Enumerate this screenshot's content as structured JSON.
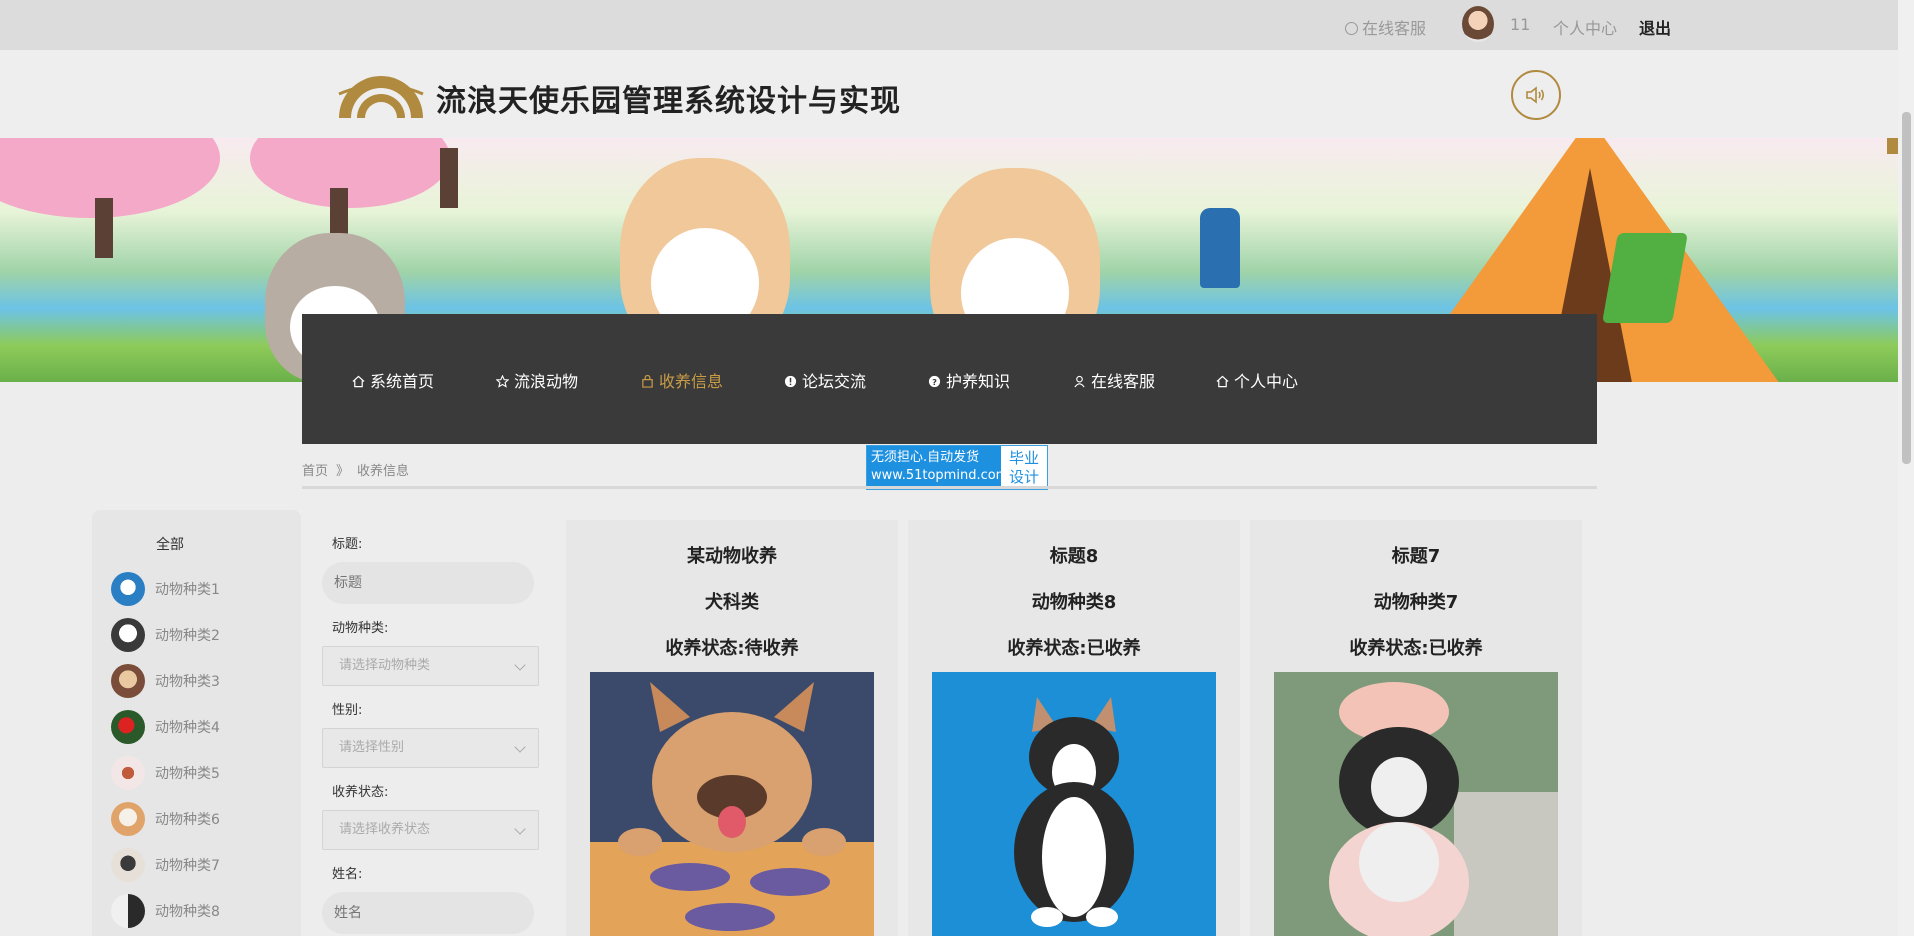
{
  "topbar": {
    "service_label": "在线客服",
    "username": "11",
    "center_label": "个人中心",
    "logout_label": "退出"
  },
  "header": {
    "title": "流浪天使乐园管理系统设计与实现"
  },
  "nav": {
    "items": [
      {
        "label": "系统首页",
        "icon": "home-icon"
      },
      {
        "label": "流浪动物",
        "icon": "star-icon"
      },
      {
        "label": "收养信息",
        "icon": "bag-icon",
        "active": true
      },
      {
        "label": "论坛交流",
        "icon": "alert-icon"
      },
      {
        "label": "护养知识",
        "icon": "question-icon"
      },
      {
        "label": "在线客服",
        "icon": "user-icon"
      },
      {
        "label": "个人中心",
        "icon": "home-icon"
      }
    ]
  },
  "ad": {
    "line1": "无须担心.自动发货",
    "line2": "www.51topmind.com",
    "badge1": "毕业",
    "badge2": "设计"
  },
  "breadcrumb": {
    "home": "首页",
    "separator": "》",
    "current": "收养信息"
  },
  "categories": {
    "all": "全部",
    "items": [
      "动物种类1",
      "动物种类2",
      "动物种类3",
      "动物种类4",
      "动物种类5",
      "动物种类6",
      "动物种类7",
      "动物种类8"
    ]
  },
  "filters": {
    "title_label": "标题:",
    "title_placeholder": "标题",
    "species_label": "动物种类:",
    "species_placeholder": "请选择动物种类",
    "gender_label": "性别:",
    "gender_placeholder": "请选择性别",
    "status_label": "收养状态:",
    "status_placeholder": "请选择收养状态",
    "name_label": "姓名:",
    "name_placeholder": "姓名"
  },
  "cards": [
    {
      "title": "某动物收养",
      "species": "犬科类",
      "status": "收养状态:待收养"
    },
    {
      "title": "标题8",
      "species": "动物种类8",
      "status": "收养状态:已收养"
    },
    {
      "title": "标题7",
      "species": "动物种类7",
      "status": "收养状态:已收养"
    }
  ],
  "colors": {
    "accent": "#c99b46",
    "nav_bg": "#3a3a3a"
  }
}
